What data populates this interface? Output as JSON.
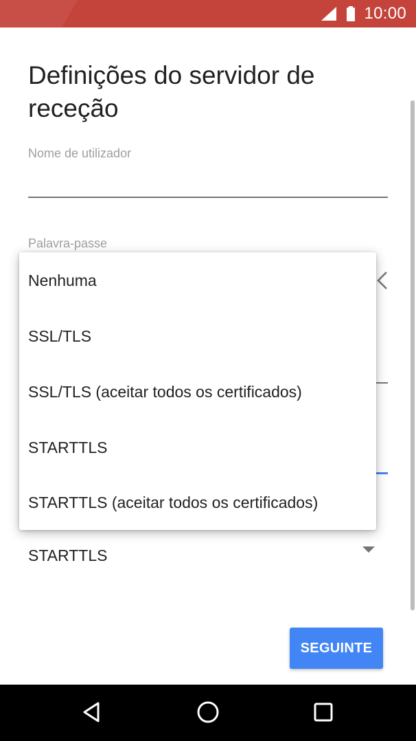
{
  "status_bar": {
    "time": "10:00",
    "icons": [
      "signal-icon",
      "battery-icon"
    ],
    "color": "#c4443c"
  },
  "page": {
    "title": "Definições do servidor de receção"
  },
  "fields": {
    "username_label": "Nome de utilizador",
    "password_label": "Palavra-passe"
  },
  "security": {
    "selected_value": "STARTTLS"
  },
  "dropdown": {
    "options": [
      "Nenhuma",
      "SSL/TLS",
      "SSL/TLS (aceitar todos os certificados)",
      "STARTTLS",
      "STARTTLS (aceitar todos os certificados)"
    ]
  },
  "actions": {
    "next_label": "SEGUINTE",
    "accent": "#4285f4"
  },
  "nav_bar": {
    "icons": [
      "back-icon",
      "home-icon",
      "recents-icon"
    ]
  }
}
